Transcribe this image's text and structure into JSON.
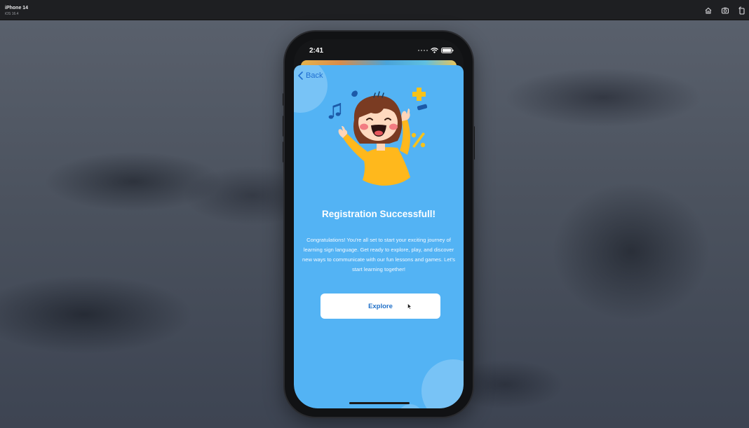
{
  "simulator": {
    "device_name": "iPhone 14",
    "os_version": "iOS 16.4",
    "icons": [
      "home-icon",
      "screenshot-icon",
      "rotate-icon"
    ]
  },
  "status_bar": {
    "time": "2:41",
    "icons": [
      "signal-dots-icon",
      "wifi-icon",
      "battery-icon"
    ]
  },
  "nav": {
    "back_label": "Back",
    "back_icon": "chevron-left-icon"
  },
  "content": {
    "title": "Registration Successfull!",
    "description": "Congratulations! You're all set to start your exciting journey of learning sign language. Get ready to explore, play, and discover new ways to communicate with our fun lessons and games. Let's start learning together!",
    "illustration": "cheering-girl-illustration"
  },
  "actions": {
    "explore_label": "Explore"
  },
  "colors": {
    "card_background": "#53b3f4",
    "accent_blue": "#1f6fd1",
    "button_background": "#ffffff",
    "shirt_yellow": "#ffb81c"
  }
}
